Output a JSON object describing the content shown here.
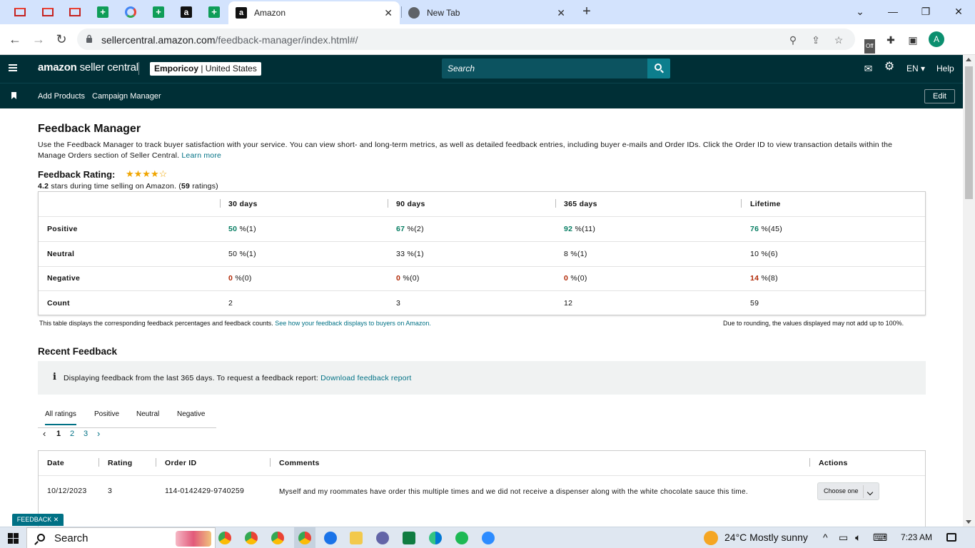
{
  "browser": {
    "tabs": [
      {
        "title": "Amazon",
        "favicon_letter": "a",
        "active": true
      },
      {
        "title": "New Tab",
        "favicon_letter": "",
        "active": false
      }
    ],
    "pinned_tabs": [
      "gmail-icon",
      "gmail-icon",
      "gmail-icon",
      "sheets-icon",
      "google-icon",
      "sheets-icon",
      "amazon-icon",
      "sheets-icon"
    ],
    "pin_letters": {
      "sheets": "+",
      "amazon": "a"
    },
    "close_glyph": "✕",
    "new_tab_glyph": "+",
    "url_domain": "sellercentral.amazon.com",
    "url_path": "/feedback-manager/index.html#/",
    "profile_initial": "A",
    "ext_off_label": "Off"
  },
  "header": {
    "logo_brand": "amazon",
    "logo_product": " seller central",
    "store_name": "Emporicoy",
    "store_region": " | United States",
    "search_placeholder": "Search",
    "language": "EN",
    "help": "Help",
    "subnav": [
      "Add Products",
      "Campaign Manager"
    ],
    "edit": "Edit"
  },
  "page": {
    "title": "Feedback Manager",
    "intro": "Use the Feedback Manager to track buyer satisfaction with your service. You can view short- and long-term metrics, as well as detailed feedback entries, including buyer e-mails and Order IDs. Click the Order ID to view transaction details within the Manage Orders section of Seller Central. ",
    "learn_more": "Learn more",
    "rating_title": "Feedback Rating:",
    "stars_display": "★★★★☆",
    "rating_value": "4.2",
    "rating_text_mid": " stars during time selling on Amazon. (",
    "rating_count": "59",
    "rating_text_end": " ratings)"
  },
  "metrics": {
    "columns": [
      "30 days",
      "90 days",
      "365 days",
      "Lifetime"
    ],
    "rows": [
      {
        "label": "Positive",
        "type": "pos",
        "values": [
          [
            "50",
            " %(1)"
          ],
          [
            "67",
            " %(2)"
          ],
          [
            "92",
            " %(11)"
          ],
          [
            "76",
            " %(45)"
          ]
        ]
      },
      {
        "label": "Neutral",
        "type": "neu",
        "values": [
          [
            "50",
            " %(1)"
          ],
          [
            "33",
            " %(1)"
          ],
          [
            "8",
            " %(1)"
          ],
          [
            "10",
            " %(6)"
          ]
        ]
      },
      {
        "label": "Negative",
        "type": "neg",
        "values": [
          [
            "0",
            " %(0)"
          ],
          [
            "0",
            " %(0)"
          ],
          [
            "0",
            " %(0)"
          ],
          [
            "14",
            " %(8)"
          ]
        ]
      },
      {
        "label": "Count",
        "type": "count",
        "values": [
          [
            "2",
            ""
          ],
          [
            "3",
            ""
          ],
          [
            "12",
            ""
          ],
          [
            "59",
            ""
          ]
        ]
      }
    ],
    "footnote_left": "This table displays the corresponding feedback percentages and feedback counts. ",
    "footnote_link": "See how your feedback displays to buyers on Amazon.",
    "footnote_right": "Due to rounding, the values displayed may not add up to 100%."
  },
  "recent": {
    "title": "Recent Feedback",
    "info_glyph": "i",
    "info_text": "Displaying feedback from the last 365 days. To request a feedback report: ",
    "info_link": "Download feedback report",
    "filter_tabs": [
      "All ratings",
      "Positive",
      "Neutral",
      "Negative"
    ],
    "pager": {
      "prev": "‹",
      "pages": [
        "1",
        "2",
        "3"
      ],
      "next": "›"
    },
    "columns": [
      "Date",
      "Rating",
      "Order ID",
      "Comments",
      "Actions"
    ],
    "rows": [
      {
        "date": "10/12/2023",
        "rating": "3",
        "order_id": "114-0142429-9740259",
        "comment": "Myself and my roommates have order this multiple times and we did not receive a dispenser along with the white chocolate sauce this time.",
        "action": "Choose one"
      }
    ],
    "feedback_tag": "FEEDBACK ✕"
  },
  "taskbar": {
    "search": "Search",
    "weather": "24°C  Mostly sunny",
    "time": "7:23 AM",
    "tray_glyph": "^"
  },
  "colors": {
    "header_bg": "#002f36",
    "search_bg": "#0c5360",
    "link": "#007185",
    "positive": "#067d62",
    "negative": "#b12704",
    "star": "#f0a500"
  }
}
